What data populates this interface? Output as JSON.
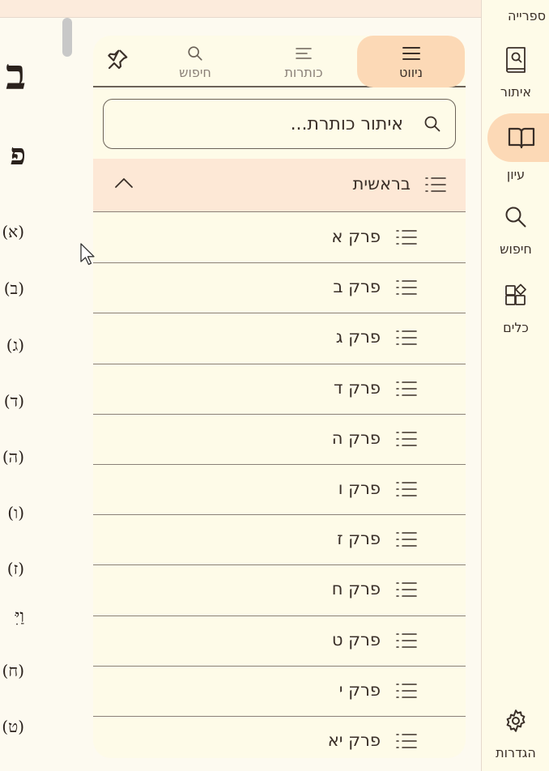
{
  "reader": {
    "title": "ב",
    "subtitle": "פ",
    "verses": [
      "(א)",
      "(ב)",
      "(ג)",
      "(ד)",
      "(ה)",
      "(ו)",
      "(ז)",
      "וַיִּ",
      "(ח)",
      "(ט)"
    ]
  },
  "panel": {
    "tabs": [
      {
        "label": "ניווט",
        "icon": "menu-icon",
        "active": true
      },
      {
        "label": "כותרות",
        "icon": "headings-icon",
        "active": false
      },
      {
        "label": "חיפוש",
        "icon": "search-icon",
        "active": false
      }
    ],
    "search": {
      "placeholder": "איתור כותרת..."
    },
    "book": {
      "label": "בראשית"
    },
    "chapters": [
      "פרק א",
      "פרק ב",
      "פרק ג",
      "פרק ד",
      "פרק ה",
      "פרק ו",
      "פרק ז",
      "פרק ח",
      "פרק ט",
      "פרק י",
      "פרק יא"
    ]
  },
  "rail": {
    "top_label": "ספרייה",
    "items": [
      {
        "label": "איתור",
        "icon": "book-search-icon"
      },
      {
        "label": "עיון",
        "icon": "open-book-icon",
        "active": true
      },
      {
        "label": "חיפוש",
        "icon": "search-icon"
      },
      {
        "label": "כלים",
        "icon": "tools-icon"
      },
      {
        "label": "הגדרות",
        "icon": "gear-icon"
      }
    ]
  },
  "colors": {
    "accent": "#fcd9b6",
    "book_row": "#fde8d6",
    "panel_bg": "#fefbe8"
  }
}
